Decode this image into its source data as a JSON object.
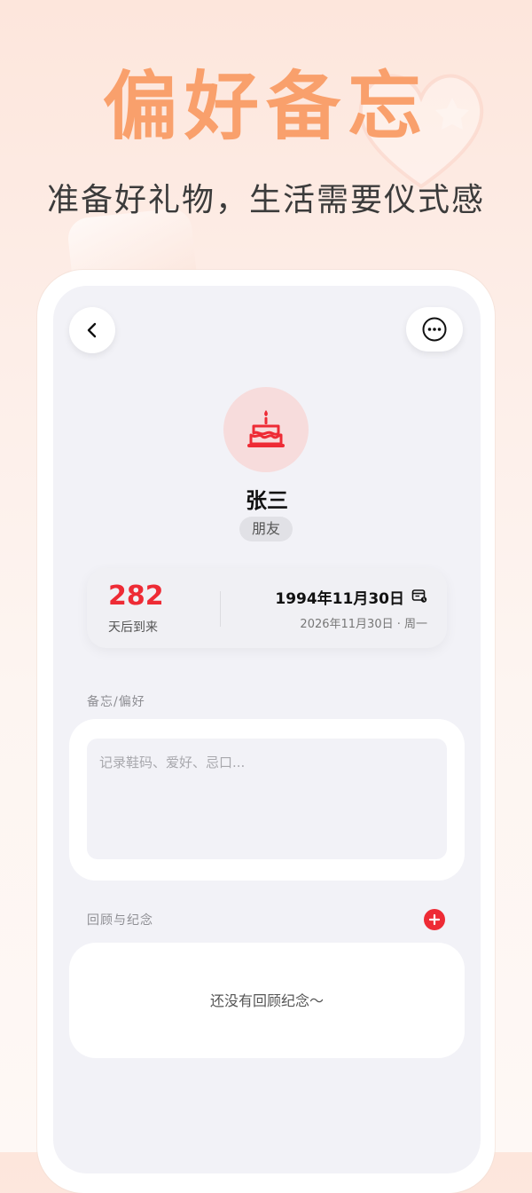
{
  "promo": {
    "title": "偏好备忘",
    "subtitle": "准备好礼物，生活需要仪式感"
  },
  "header": {
    "back_icon": "chevron-left-icon",
    "more_icon": "more-horizontal-icon"
  },
  "contact": {
    "avatar_icon": "birthday-cake-icon",
    "name": "张三",
    "relation": "朋友"
  },
  "countdown": {
    "days": "282",
    "days_label": "天后到来",
    "birth_date": "1994年11月30日",
    "next_date": "2026年11月30日 · 周一",
    "calendar_icon": "calendar-icon"
  },
  "notes": {
    "title": "备忘/偏好",
    "placeholder": "记录鞋码、爱好、忌口..."
  },
  "memories": {
    "title": "回顾与纪念",
    "add_icon": "plus-icon",
    "empty_text": "还没有回顾纪念～"
  },
  "colors": {
    "accent_orange": "#f9a06c",
    "accent_red": "#ee2b35",
    "avatar_bg": "#f7dcdc",
    "screen_bg": "#f2f2f7"
  }
}
